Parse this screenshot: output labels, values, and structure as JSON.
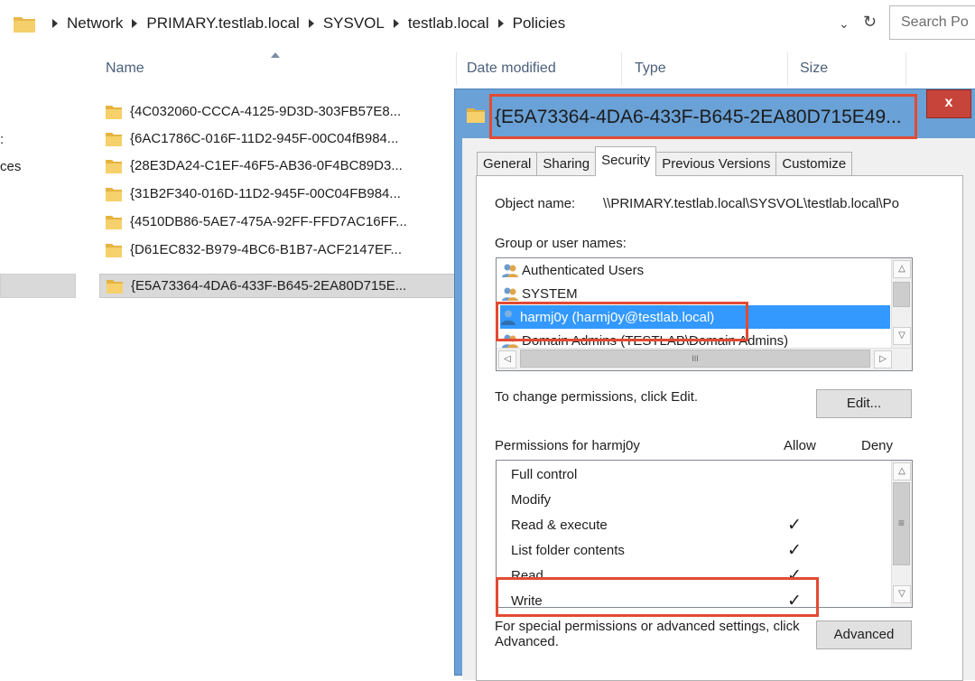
{
  "address_bar": {
    "breadcrumbs": [
      "Network",
      "PRIMARY.testlab.local",
      "SYSVOL",
      "testlab.local",
      "Policies"
    ],
    "search_placeholder": "Search Po"
  },
  "nav_fragments": [
    ":",
    "ces"
  ],
  "columns": {
    "name": "Name",
    "date_modified": "Date modified",
    "type": "Type",
    "size": "Size"
  },
  "files": [
    "{4C032060-CCCA-4125-9D3D-303FB57E8...",
    "{6AC1786C-016F-11D2-945F-00C04fB984...",
    "{28E3DA24-C1EF-46F5-AB36-0F4BC89D3...",
    "{31B2F340-016D-11D2-945F-00C04FB984...",
    "{4510DB86-5AE7-475A-92FF-FFD7AC16FF...",
    "{D61EC832-B979-4BC6-B1B7-ACF2147EF...",
    "{E5A73364-4DA6-433F-B645-2EA80D715E..."
  ],
  "dialog": {
    "title": "{E5A73364-4DA6-433F-B645-2EA80D715E49...",
    "close": "x",
    "tabs": [
      "General",
      "Sharing",
      "Security",
      "Previous Versions",
      "Customize"
    ],
    "object_name_label": "Object name:",
    "object_name_value": "\\\\PRIMARY.testlab.local\\SYSVOL\\testlab.local\\Po",
    "group_label": "Group or user names:",
    "groups": [
      "Authenticated Users",
      "SYSTEM",
      "harmj0y (harmj0y@testlab.local)",
      "Domain Admins (TESTLAB\\Domain Admins)"
    ],
    "change_text": "To change permissions, click Edit.",
    "edit_button": "Edit...",
    "permissions_label": "Permissions for harmj0y",
    "allow_header": "Allow",
    "deny_header": "Deny",
    "permissions": [
      {
        "name": "Full control",
        "allow": ""
      },
      {
        "name": "Modify",
        "allow": ""
      },
      {
        "name": "Read & execute",
        "allow": "✓"
      },
      {
        "name": "List folder contents",
        "allow": "✓"
      },
      {
        "name": "Read",
        "allow": "✓"
      },
      {
        "name": "Write",
        "allow": "✓"
      }
    ],
    "special_text": "For special permissions or advanced settings, click Advanced.",
    "advanced_button": "Advanced"
  },
  "colors": {
    "highlight": "#e24b34",
    "selection": "#3399ff",
    "title_bar": "#6aa1d6",
    "close": "#c7443a"
  }
}
